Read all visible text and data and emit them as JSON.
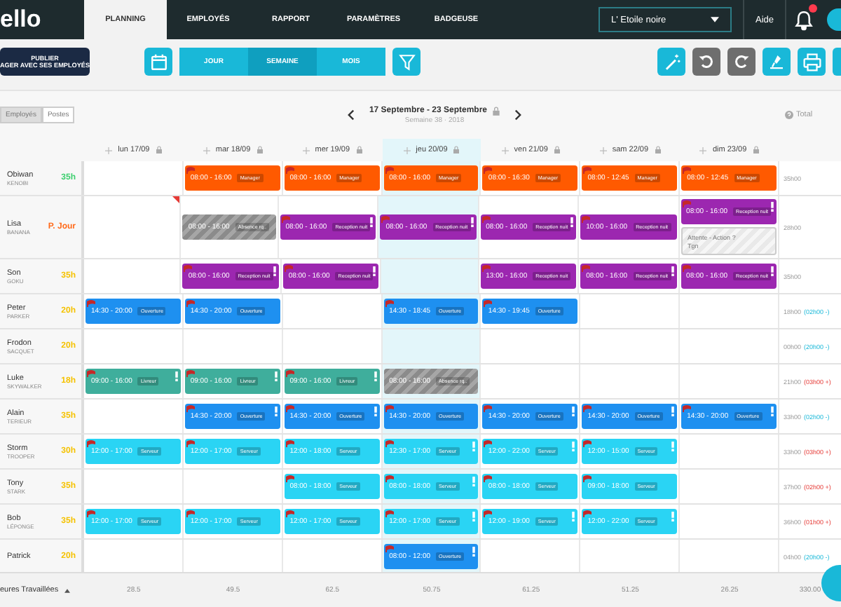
{
  "nav": {
    "logo": "ello",
    "tabs": [
      {
        "label": "PLANNING",
        "selected": true
      },
      {
        "label": "EMPLOYÉS",
        "selected": false
      },
      {
        "label": "RAPPORT",
        "selected": false
      },
      {
        "label": "PARAMÈTRES",
        "selected": false
      },
      {
        "label": "BADGEUSE",
        "selected": false
      }
    ],
    "venue": "L' Etoile noire",
    "help": "Aide"
  },
  "toolbar": {
    "publish": "PUBLIER",
    "publish_sub": "AGER AVEC SES EMPLOYÉS",
    "views": [
      {
        "label": "JOUR",
        "selected": false
      },
      {
        "label": "SEMAINE",
        "selected": true
      },
      {
        "label": "MOIS",
        "selected": false
      }
    ]
  },
  "planning": {
    "modes": [
      {
        "label": "Employés",
        "selected": true
      },
      {
        "label": "Postes",
        "selected": false
      }
    ],
    "week": "17 Septembre - 23 Septembre",
    "week_sub": "Semaine 38 · 2018",
    "total_label": "Total",
    "days": [
      {
        "label": "lun 17/09",
        "today": false
      },
      {
        "label": "mar 18/09",
        "today": false
      },
      {
        "label": "mer 19/09",
        "today": false
      },
      {
        "label": "jeu 20/09",
        "today": true
      },
      {
        "label": "ven 21/09",
        "today": false
      },
      {
        "label": "sam 22/09",
        "today": false
      },
      {
        "label": "dim 23/09",
        "today": false
      }
    ],
    "employees": [
      {
        "first": "Obiwan",
        "last": "KENOBI",
        "hours": "35h",
        "color": "#3ccf6e",
        "total": "35h00",
        "days": [
          {
            "comment": false
          },
          {
            "comment": false,
            "shifts": [
              {
                "time": "08:00 - 16:00",
                "role": "Manager",
                "kind": "manager",
                "alert": false
              }
            ]
          },
          {
            "comment": false,
            "shifts": [
              {
                "time": "08:00 - 16:00",
                "role": "Manager",
                "kind": "manager",
                "alert": false
              }
            ]
          },
          {
            "comment": false,
            "shifts": [
              {
                "time": "08:00 - 16:00",
                "role": "Manager",
                "kind": "manager",
                "alert": false
              }
            ]
          },
          {
            "comment": false,
            "shifts": [
              {
                "time": "08:00 - 16:30",
                "role": "Manager",
                "kind": "manager",
                "alert": false
              }
            ]
          },
          {
            "comment": false,
            "shifts": [
              {
                "time": "08:00 - 12:45",
                "role": "Manager",
                "kind": "manager",
                "alert": false
              }
            ]
          },
          {
            "comment": false,
            "shifts": [
              {
                "time": "08:00 - 12:45",
                "role": "Manager",
                "kind": "manager",
                "alert": false
              }
            ]
          }
        ]
      },
      {
        "first": "Lisa",
        "last": "BANANA",
        "hours": "P. Jour",
        "color": "#ff6a1a",
        "total": "28h00",
        "days": [
          {
            "comment": true
          },
          {
            "comment": false,
            "shifts": [
              {
                "time": "08:00 - 16:00",
                "role": "Absence rq..",
                "kind": "absence",
                "alert": false
              }
            ]
          },
          {
            "comment": false,
            "shifts": [
              {
                "time": "08:00 - 16:00",
                "role": "Reception nuit",
                "kind": "reception",
                "alert": true
              }
            ]
          },
          {
            "comment": false,
            "shifts": [
              {
                "time": "08:00 - 16:00",
                "role": "Reception nuit",
                "kind": "reception",
                "alert": true
              }
            ]
          },
          {
            "comment": false,
            "shifts": [
              {
                "time": "08:00 - 16:00",
                "role": "Reception nuit",
                "kind": "reception",
                "alert": true
              }
            ]
          },
          {
            "comment": false,
            "shifts": [
              {
                "time": "10:00 - 16:00",
                "role": "Reception nuit",
                "kind": "reception",
                "alert": false
              }
            ]
          },
          {
            "comment": false,
            "shifts": [
              {
                "time": "08:00 - 16:00",
                "role": "Reception nuit",
                "kind": "reception",
                "alert": true
              },
              {
                "time": "Attente - Action ?",
                "role": "Tgn",
                "kind": "pending",
                "alert": false
              }
            ]
          }
        ]
      },
      {
        "first": "Son",
        "last": "GOKU",
        "hours": "35h",
        "color": "#f5c200",
        "total": "35h00",
        "days": [
          {
            "comment": false
          },
          {
            "comment": false,
            "shifts": [
              {
                "time": "08:00 - 16:00",
                "role": "Reception nuit",
                "kind": "reception",
                "alert": true
              }
            ]
          },
          {
            "comment": false,
            "shifts": [
              {
                "time": "08:00 - 16:00",
                "role": "Reception nuit",
                "kind": "reception",
                "alert": true
              }
            ]
          },
          {
            "comment": false
          },
          {
            "comment": false,
            "shifts": [
              {
                "time": "13:00 - 16:00",
                "role": "Reception nuit",
                "kind": "reception",
                "alert": false
              }
            ]
          },
          {
            "comment": false,
            "shifts": [
              {
                "time": "08:00 - 16:00",
                "role": "Reception nuit",
                "kind": "reception",
                "alert": true
              }
            ]
          },
          {
            "comment": false,
            "shifts": [
              {
                "time": "08:00 - 16:00",
                "role": "Reception nuit",
                "kind": "reception",
                "alert": true
              }
            ]
          }
        ]
      },
      {
        "first": "Peter",
        "last": "PARKER",
        "hours": "20h",
        "color": "#f5c200",
        "total": "18h00",
        "diff": {
          "text": "(02h00 -)",
          "kind": "under"
        },
        "days": [
          {
            "comment": false,
            "shifts": [
              {
                "time": "14:30 - 20:00",
                "role": "Ouverture",
                "kind": "ouverture",
                "alert": false
              }
            ]
          },
          {
            "comment": false,
            "shifts": [
              {
                "time": "14:30 - 20:00",
                "role": "Ouverture",
                "kind": "ouverture",
                "alert": false
              }
            ]
          },
          {
            "comment": false
          },
          {
            "comment": false,
            "shifts": [
              {
                "time": "14:30 - 18:45",
                "role": "Ouverture",
                "kind": "ouverture",
                "alert": false
              }
            ]
          },
          {
            "comment": false,
            "shifts": [
              {
                "time": "14:30 - 19:45",
                "role": "Ouverture",
                "kind": "ouverture",
                "alert": false
              }
            ]
          },
          {
            "comment": false
          },
          {
            "comment": false
          }
        ]
      },
      {
        "first": "Frodon",
        "last": "SACQUET",
        "hours": "20h",
        "color": "#f5c200",
        "total": "00h00",
        "diff": {
          "text": "(20h00 -)",
          "kind": "under"
        },
        "days": [
          {
            "comment": false
          },
          {
            "comment": false
          },
          {
            "comment": false
          },
          {
            "comment": false
          },
          {
            "comment": false
          },
          {
            "comment": false
          },
          {
            "comment": false
          }
        ]
      },
      {
        "first": "Luke",
        "last": "SKYWALKER",
        "hours": "18h",
        "color": "#f5c200",
        "total": "21h00",
        "diff": {
          "text": "(03h00 +)",
          "kind": "over"
        },
        "days": [
          {
            "comment": false,
            "shifts": [
              {
                "time": "09:00 - 16:00",
                "role": "Livreur",
                "kind": "livreur",
                "alert": true
              }
            ]
          },
          {
            "comment": false,
            "shifts": [
              {
                "time": "09:00 - 16:00",
                "role": "Livreur",
                "kind": "livreur",
                "alert": true
              }
            ]
          },
          {
            "comment": false,
            "shifts": [
              {
                "time": "09:00 - 16:00",
                "role": "Livreur",
                "kind": "livreur",
                "alert": true
              }
            ]
          },
          {
            "comment": false,
            "shifts": [
              {
                "time": "08:00 - 16:00",
                "role": "Absence rq..",
                "kind": "absence",
                "alert": false
              }
            ]
          },
          {
            "comment": false
          },
          {
            "comment": false
          },
          {
            "comment": false
          }
        ]
      },
      {
        "first": "Alain",
        "last": "TERIEUR",
        "hours": "35h",
        "color": "#f5c200",
        "total": "33h00",
        "diff": {
          "text": "(02h00 -)",
          "kind": "under"
        },
        "days": [
          {
            "comment": false
          },
          {
            "comment": false,
            "shifts": [
              {
                "time": "14:30 - 20:00",
                "role": "Ouverture",
                "kind": "ouverture",
                "alert": true
              }
            ]
          },
          {
            "comment": false,
            "shifts": [
              {
                "time": "14:30 - 20:00",
                "role": "Ouverture",
                "kind": "ouverture",
                "alert": true
              }
            ]
          },
          {
            "comment": false,
            "shifts": [
              {
                "time": "14:30 - 20:00",
                "role": "Ouverture",
                "kind": "ouverture",
                "alert": false
              }
            ]
          },
          {
            "comment": false,
            "shifts": [
              {
                "time": "14:30 - 20:00",
                "role": "Ouverture",
                "kind": "ouverture",
                "alert": true
              }
            ]
          },
          {
            "comment": false,
            "shifts": [
              {
                "time": "14:30 - 20:00",
                "role": "Ouverture",
                "kind": "ouverture",
                "alert": true
              }
            ]
          },
          {
            "comment": false,
            "shifts": [
              {
                "time": "14:30 - 20:00",
                "role": "Ouverture",
                "kind": "ouverture",
                "alert": true
              }
            ]
          }
        ]
      },
      {
        "first": "Storm",
        "last": "TROOPER",
        "hours": "30h",
        "color": "#f5c200",
        "total": "33h00",
        "diff": {
          "text": "(03h00 +)",
          "kind": "over"
        },
        "days": [
          {
            "comment": false,
            "shifts": [
              {
                "time": "12:00 - 17:00",
                "role": "Serveur",
                "kind": "serveur",
                "alert": false
              }
            ]
          },
          {
            "comment": false,
            "shifts": [
              {
                "time": "12:00 - 17:00",
                "role": "Serveur",
                "kind": "serveur",
                "alert": false
              }
            ]
          },
          {
            "comment": false,
            "shifts": [
              {
                "time": "12:00 - 18:00",
                "role": "Serveur",
                "kind": "serveur",
                "alert": false
              }
            ]
          },
          {
            "comment": false,
            "shifts": [
              {
                "time": "12:30 - 17:00",
                "role": "Serveur",
                "kind": "serveur",
                "alert": true
              }
            ]
          },
          {
            "comment": false,
            "shifts": [
              {
                "time": "12:00 - 22:00",
                "role": "Serveur",
                "kind": "serveur",
                "alert": true
              }
            ]
          },
          {
            "comment": false,
            "shifts": [
              {
                "time": "12:00 - 15:00",
                "role": "Serveur",
                "kind": "serveur",
                "alert": true
              }
            ]
          },
          {
            "comment": false
          }
        ]
      },
      {
        "first": "Tony",
        "last": "STARK",
        "hours": "35h",
        "color": "#f5c200",
        "total": "37h00",
        "diff": {
          "text": "(02h00 +)",
          "kind": "over"
        },
        "days": [
          {
            "comment": false
          },
          {
            "comment": false
          },
          {
            "comment": false,
            "shifts": [
              {
                "time": "08:00 - 18:00",
                "role": "Serveur",
                "kind": "serveur",
                "alert": false
              }
            ]
          },
          {
            "comment": false,
            "shifts": [
              {
                "time": "08:00 - 18:00",
                "role": "Serveur",
                "kind": "serveur",
                "alert": true
              }
            ]
          },
          {
            "comment": false,
            "shifts": [
              {
                "time": "08:00 - 18:00",
                "role": "Serveur",
                "kind": "serveur",
                "alert": false
              }
            ]
          },
          {
            "comment": false,
            "shifts": [
              {
                "time": "09:00 - 18:00",
                "role": "Serveur",
                "kind": "serveur",
                "alert": false
              }
            ]
          },
          {
            "comment": false
          }
        ]
      },
      {
        "first": "Bob",
        "last": "LÉPONGE",
        "hours": "35h",
        "color": "#f5c200",
        "total": "36h00",
        "diff": {
          "text": "(01h00 +)",
          "kind": "over"
        },
        "days": [
          {
            "comment": false,
            "shifts": [
              {
                "time": "12:00 - 17:00",
                "role": "Serveur",
                "kind": "serveur",
                "alert": false
              }
            ]
          },
          {
            "comment": false,
            "shifts": [
              {
                "time": "12:00 - 17:00",
                "role": "Serveur",
                "kind": "serveur",
                "alert": false
              }
            ]
          },
          {
            "comment": false,
            "shifts": [
              {
                "time": "12:00 - 17:00",
                "role": "Serveur",
                "kind": "serveur",
                "alert": false
              }
            ]
          },
          {
            "comment": false,
            "shifts": [
              {
                "time": "12:00 - 17:00",
                "role": "Serveur",
                "kind": "serveur",
                "alert": true
              }
            ]
          },
          {
            "comment": false,
            "shifts": [
              {
                "time": "12:00 - 19:00",
                "role": "Serveur",
                "kind": "serveur",
                "alert": true
              }
            ]
          },
          {
            "comment": false,
            "shifts": [
              {
                "time": "12:00 - 22:00",
                "role": "Serveur",
                "kind": "serveur",
                "alert": true
              }
            ]
          },
          {
            "comment": false
          }
        ]
      },
      {
        "first": "Patrick",
        "hours": "20h",
        "color": "#f5c200",
        "total": "04h00",
        "diff": {
          "text": "(20h00 -)",
          "kind": "under"
        },
        "days": [
          {
            "comment": false
          },
          {
            "comment": false
          },
          {
            "comment": false
          },
          {
            "comment": false,
            "shifts": [
              {
                "time": "08:00 - 12:00",
                "role": "Ouverture",
                "kind": "ouverture",
                "alert": true
              }
            ]
          },
          {
            "comment": false
          },
          {
            "comment": false
          },
          {
            "comment": false
          }
        ]
      }
    ]
  },
  "footer": {
    "label": "eures Travaillées",
    "values": [
      "28.5",
      "49.5",
      "62.5",
      "50.75",
      "61.25",
      "51.25",
      "26.25",
      "330.00"
    ]
  }
}
